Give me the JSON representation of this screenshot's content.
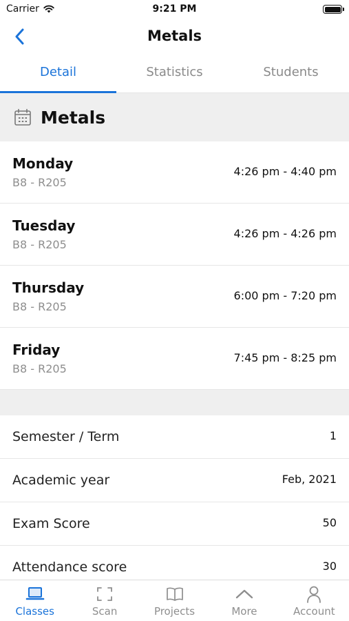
{
  "status_bar": {
    "carrier": "Carrier",
    "time": "9:21 PM"
  },
  "nav": {
    "title": "Metals"
  },
  "tabs": [
    {
      "label": "Detail",
      "active": true
    },
    {
      "label": "Statistics",
      "active": false
    },
    {
      "label": "Students",
      "active": false
    }
  ],
  "section": {
    "title": "Metals",
    "icon": "calendar-icon"
  },
  "schedule": [
    {
      "day": "Monday",
      "room": "B8 - R205",
      "time": "4:26 pm - 4:40 pm"
    },
    {
      "day": "Tuesday",
      "room": "B8 - R205",
      "time": "4:26 pm - 4:26 pm"
    },
    {
      "day": "Thursday",
      "room": "B8 - R205",
      "time": "6:00 pm - 7:20 pm"
    },
    {
      "day": "Friday",
      "room": "B8 - R205",
      "time": "7:45 pm - 8:25 pm"
    }
  ],
  "info": [
    {
      "label": "Semester / Term",
      "value": "1"
    },
    {
      "label": "Academic year",
      "value": "Feb, 2021"
    },
    {
      "label": "Exam Score",
      "value": "50"
    },
    {
      "label": "Attendance score",
      "value": "30"
    }
  ],
  "tab_bar": [
    {
      "label": "Classes",
      "icon": "laptop-icon",
      "active": true
    },
    {
      "label": "Scan",
      "icon": "scan-icon",
      "active": false
    },
    {
      "label": "Projects",
      "icon": "book-icon",
      "active": false
    },
    {
      "label": "More",
      "icon": "chevron-up-icon",
      "active": false
    },
    {
      "label": "Account",
      "icon": "person-icon",
      "active": false
    }
  ],
  "colors": {
    "accent": "#1a73d9",
    "muted": "#8e8e8e",
    "section_bg": "#efefef"
  }
}
